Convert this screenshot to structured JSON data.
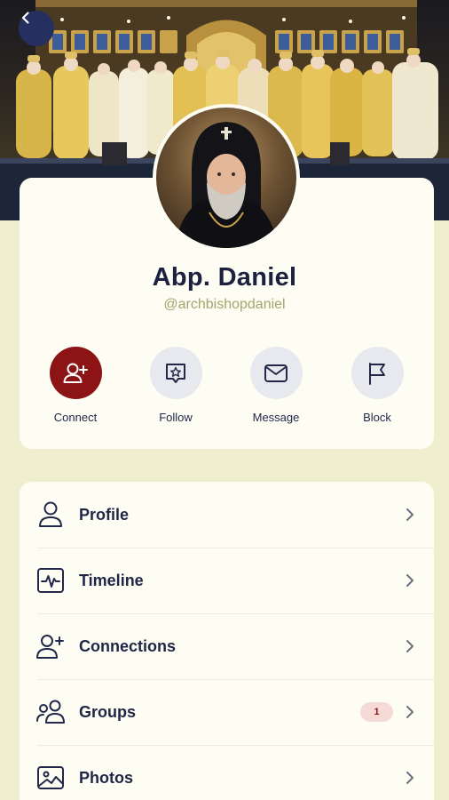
{
  "profile": {
    "name": "Abp. Daniel",
    "handle": "@archbishopdaniel"
  },
  "actions": [
    {
      "label": "Connect",
      "icon": "add-user-icon"
    },
    {
      "label": "Follow",
      "icon": "star-badge-icon"
    },
    {
      "label": "Message",
      "icon": "envelope-icon"
    },
    {
      "label": "Block",
      "icon": "flag-icon"
    }
  ],
  "menu": [
    {
      "label": "Profile",
      "icon": "user-icon"
    },
    {
      "label": "Timeline",
      "icon": "activity-icon"
    },
    {
      "label": "Connections",
      "icon": "user-plus-icon"
    },
    {
      "label": "Groups",
      "icon": "group-icon",
      "badge": "1"
    },
    {
      "label": "Photos",
      "icon": "image-icon"
    }
  ],
  "colors": {
    "accent": "#8c1414",
    "navy": "#263060",
    "background": "#efefcf",
    "card": "#fdfdf4",
    "handle": "#a3a46e"
  }
}
